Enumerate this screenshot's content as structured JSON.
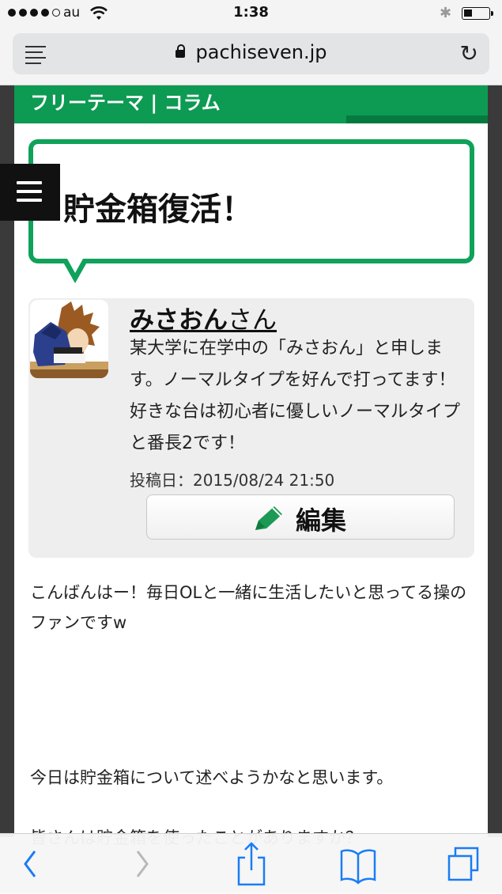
{
  "status_bar": {
    "carrier": "au",
    "time": "1:38",
    "bluetooth_icon": "bluetooth-icon",
    "battery_percent": 30
  },
  "url_bar": {
    "domain": "pachiseven.jp",
    "reader_icon": "reader-icon",
    "lock_icon": "lock-icon",
    "reload_icon": "reload-icon"
  },
  "page": {
    "category": "フリーテーマ | コラム",
    "title": "貯金箱復活！",
    "menu_icon": "hamburger-icon",
    "author": {
      "name": "みさおん",
      "suffix": "さん",
      "bio": "某大学に在学中の「みさおん」と申します。ノーマルタイプを好んで打ってます！ 好きな台は初心者に優しいノーマルタイプと番長2です！",
      "posted": "投稿日：2015/08/24 21:50",
      "edit_label": "編集"
    },
    "body": [
      "こんばんはー！毎日OLと一緒に生活したいと思ってる操のファンですw",
      "今日は貯金箱について述べようかなと思います。",
      "皆さんは貯金箱を使ったことがありますか？"
    ]
  },
  "colors": {
    "accent_green": "#10a25a",
    "category_green": "#0d9a52",
    "ios_blue": "#1a7cf5"
  },
  "toolbar": {
    "items": [
      "back-icon",
      "forward-icon",
      "share-icon",
      "bookmarks-icon",
      "tabs-icon"
    ]
  }
}
